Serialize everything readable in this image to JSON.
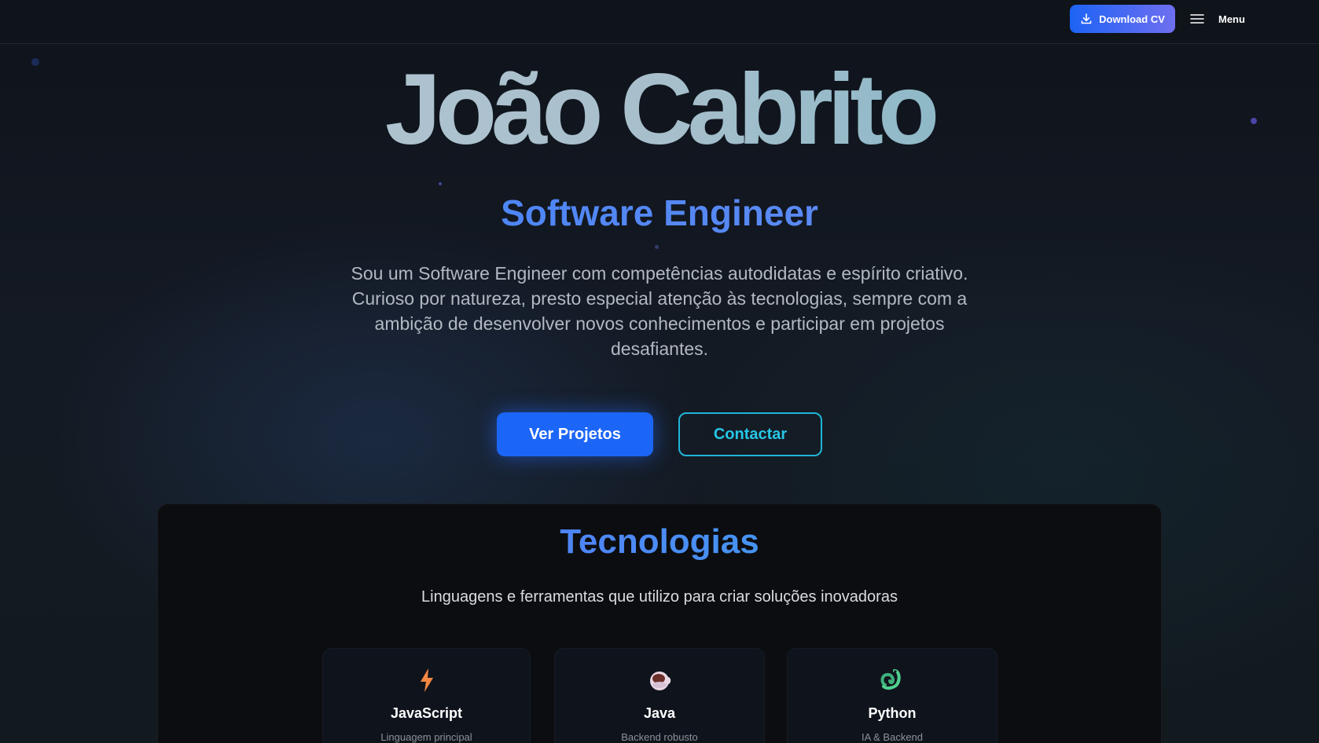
{
  "header": {
    "download_cv_label": "Download CV",
    "menu_label": "Menu"
  },
  "hero": {
    "name": "João Cabrito",
    "role": "Software Engineer",
    "description": "Sou um Software Engineer com competências autodidatas e espírito criativo. Curioso por natureza, presto especial atenção às tecnologias, sempre com a ambição de desenvolver novos conhecimentos e participar em projetos desafiantes.",
    "primary_button": "Ver Projetos",
    "secondary_button": "Contactar"
  },
  "technologies": {
    "title": "Tecnologias",
    "subtitle": "Linguagens e ferramentas que utilizo para criar soluções inovadoras",
    "items": [
      {
        "name": "JavaScript",
        "description": "Linguagem principal",
        "icon": "lightning-icon"
      },
      {
        "name": "Java",
        "description": "Backend robusto",
        "icon": "coffee-cup-icon"
      },
      {
        "name": "Python",
        "description": "IA & Backend",
        "icon": "snake-icon"
      }
    ]
  },
  "colors": {
    "accent_blue": "#1c66f7",
    "accent_cyan": "#1fb5d8",
    "background": "#0d1118"
  }
}
